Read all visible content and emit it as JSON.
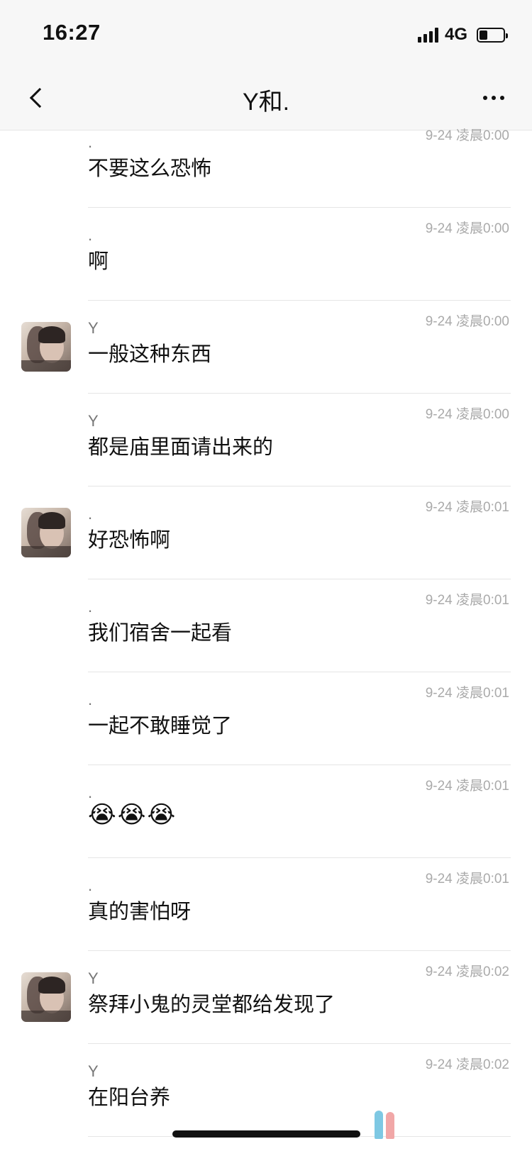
{
  "status_bar": {
    "time": "16:27",
    "network": "4G",
    "battery_percent": 35
  },
  "nav": {
    "title": "Y和.",
    "back_icon": "chevron-left-icon",
    "more_icon": "more-horizontal-icon"
  },
  "messages": [
    {
      "sender": ".",
      "time": "9-24 凌晨0:00",
      "text": "不要这么恐怖",
      "avatar": false,
      "is_emoji": false
    },
    {
      "sender": ".",
      "time": "9-24 凌晨0:00",
      "text": "啊",
      "avatar": false,
      "is_emoji": false
    },
    {
      "sender": "Y",
      "time": "9-24 凌晨0:00",
      "text": "一般这种东西",
      "avatar": true,
      "is_emoji": false
    },
    {
      "sender": "Y",
      "time": "9-24 凌晨0:00",
      "text": "都是庙里面请出来的",
      "avatar": false,
      "is_emoji": false
    },
    {
      "sender": ".",
      "time": "9-24 凌晨0:01",
      "text": "好恐怖啊",
      "avatar": true,
      "is_emoji": false
    },
    {
      "sender": ".",
      "time": "9-24 凌晨0:01",
      "text": "我们宿舍一起看",
      "avatar": false,
      "is_emoji": false
    },
    {
      "sender": ".",
      "time": "9-24 凌晨0:01",
      "text": "一起不敢睡觉了",
      "avatar": false,
      "is_emoji": false
    },
    {
      "sender": ".",
      "time": "9-24 凌晨0:01",
      "text": "😭😭😭",
      "avatar": false,
      "is_emoji": true
    },
    {
      "sender": ".",
      "time": "9-24 凌晨0:01",
      "text": "真的害怕呀",
      "avatar": false,
      "is_emoji": false
    },
    {
      "sender": "Y",
      "time": "9-24 凌晨0:02",
      "text": "祭拜小鬼的灵堂都给发现了",
      "avatar": true,
      "is_emoji": false
    },
    {
      "sender": "Y",
      "time": "9-24 凌晨0:02",
      "text": "在阳台养",
      "avatar": false,
      "is_emoji": false
    }
  ]
}
